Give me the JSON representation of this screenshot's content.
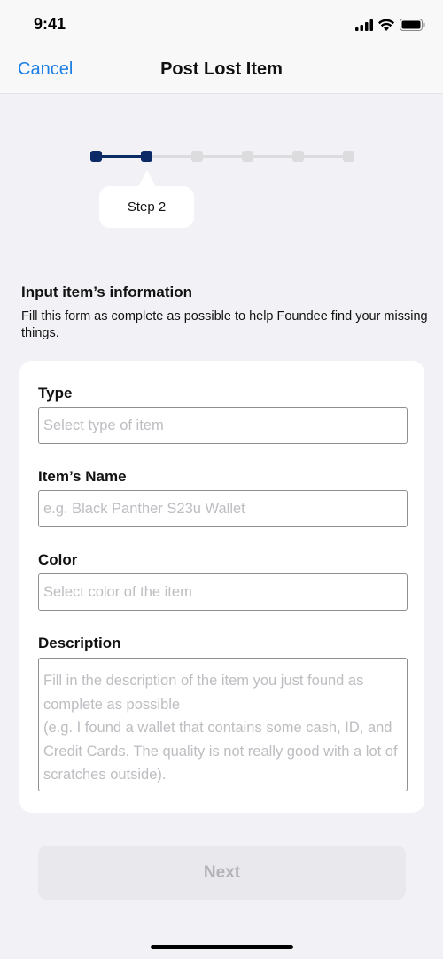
{
  "status_bar": {
    "time": "9:41",
    "icons": [
      "signal-icon",
      "wifi-icon",
      "battery-icon"
    ]
  },
  "nav": {
    "cancel_label": "Cancel",
    "title": "Post Lost Item"
  },
  "stepper": {
    "total_steps": 6,
    "current_step": 2,
    "tooltip": "Step 2"
  },
  "colors": {
    "accent": "#0b2a66",
    "link": "#1b7ee4",
    "inactive": "#dcdcdf"
  },
  "intro": {
    "heading": "Input item’s information",
    "description": "Fill this form as complete as possible to help Foundee find your missing things."
  },
  "form": {
    "type": {
      "label": "Type",
      "placeholder": "Select type of item",
      "value": ""
    },
    "name": {
      "label": "Item’s Name",
      "placeholder": "e.g. Black Panther S23u Wallet",
      "value": ""
    },
    "color": {
      "label": "Color",
      "placeholder": "Select color of the item",
      "value": ""
    },
    "description": {
      "label": "Description",
      "placeholder": "Fill in the description of the item you just found as complete as possible\n(e.g. I found a wallet that contains some cash, ID, and Credit Cards. The quality is not really good with a lot of scratches outside).",
      "value": ""
    }
  },
  "next_label": "Next"
}
